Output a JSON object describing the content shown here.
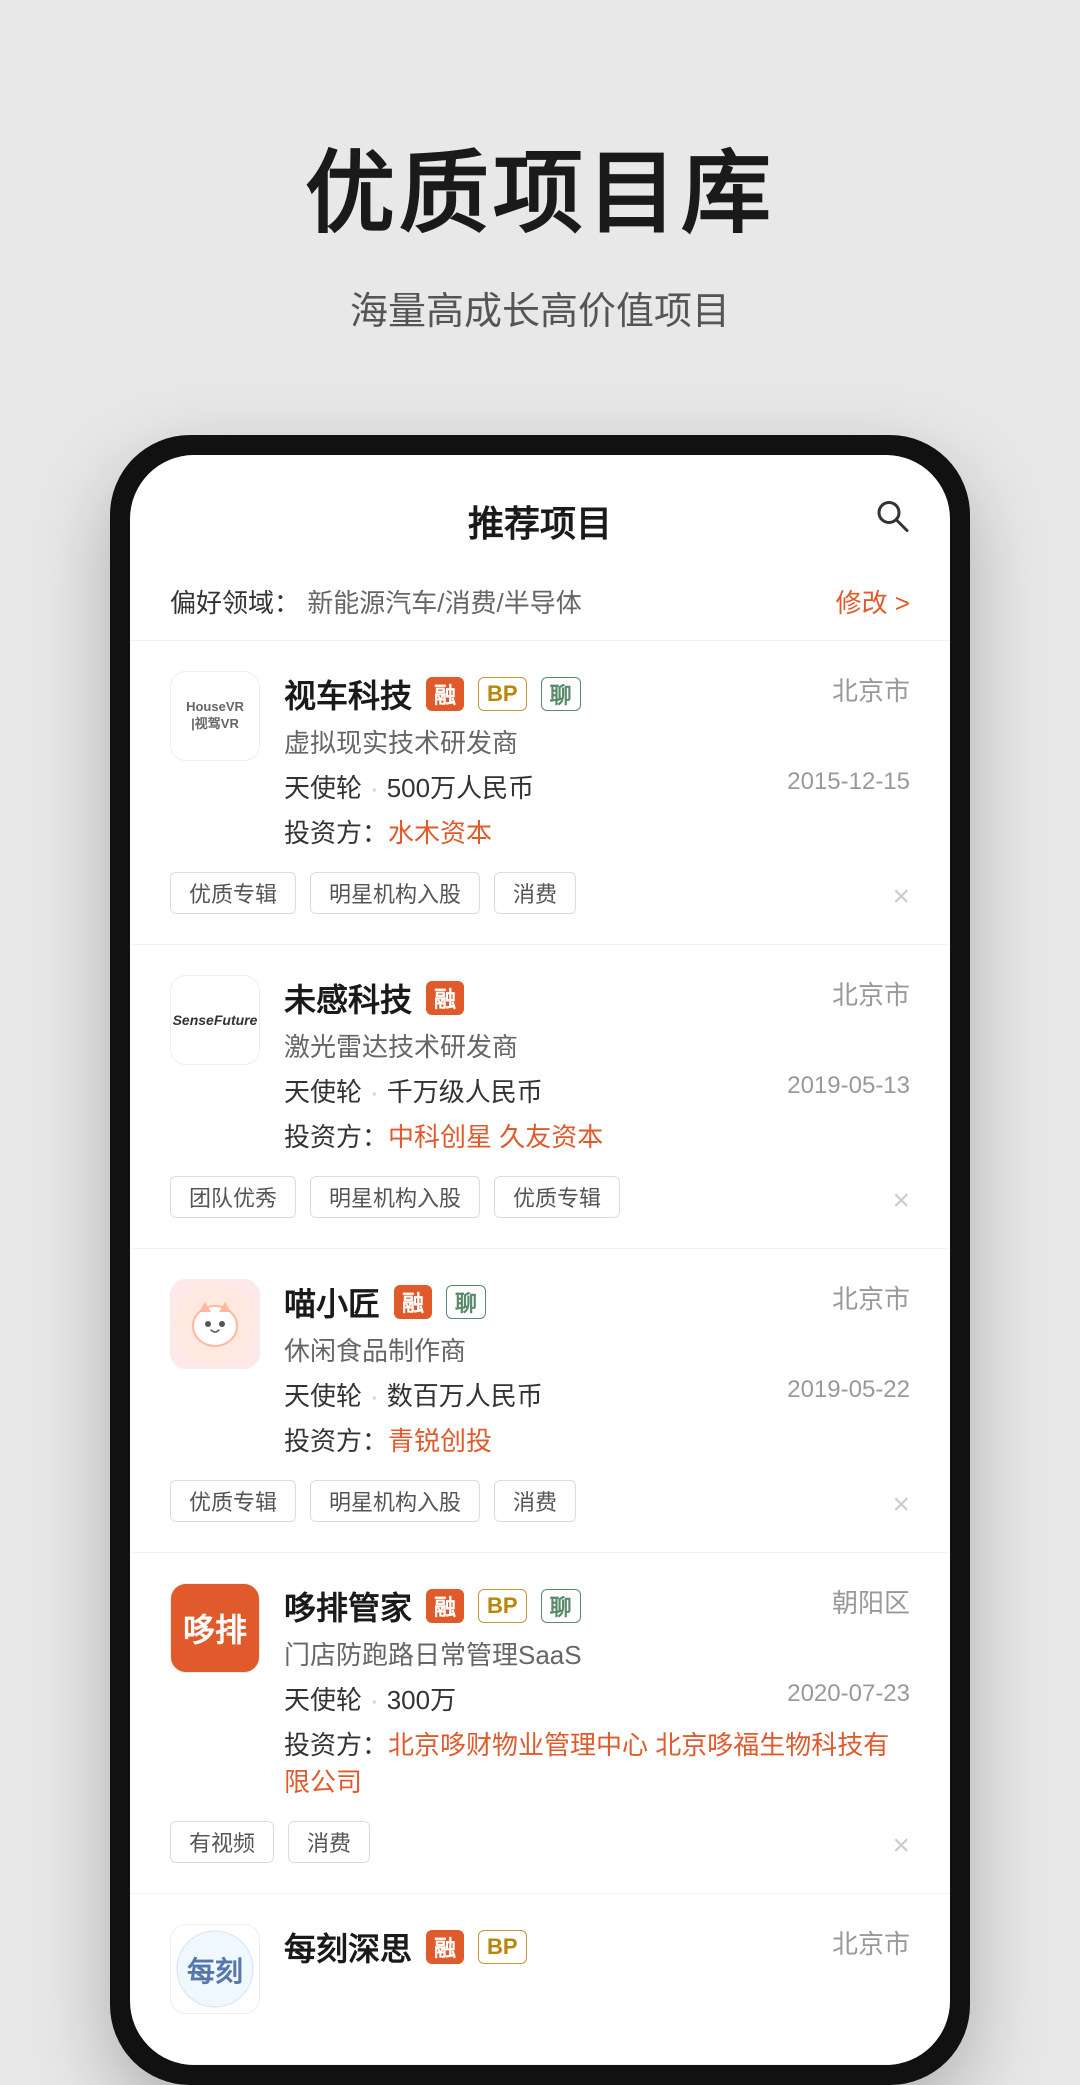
{
  "hero": {
    "title": "优质项目库",
    "subtitle": "海量高成长高价值项目"
  },
  "app": {
    "header_title": "推荐项目",
    "search_icon": "🔍",
    "preference_label": "偏好领域：",
    "preference_value": "新能源汽车/消费/半导体",
    "preference_edit": "修改 >"
  },
  "projects": [
    {
      "id": 1,
      "name": "视车科技",
      "logo_text": "HouseVR | 视驾VR",
      "logo_type": "housevr",
      "city": "北京市",
      "desc": "虚拟现实技术研发商",
      "round": "天使轮",
      "amount": "500万人民币",
      "date": "2015-12-15",
      "investor_label": "投资方：",
      "investors": [
        "水木资本"
      ],
      "tags": [
        "优质专辑",
        "明星机构入股",
        "消费"
      ],
      "badges": [
        "融",
        "BP",
        "聊"
      ]
    },
    {
      "id": 2,
      "name": "未感科技",
      "logo_text": "SenseFuture",
      "logo_type": "sensetime",
      "city": "北京市",
      "desc": "激光雷达技术研发商",
      "round": "天使轮",
      "amount": "千万级人民币",
      "date": "2019-05-13",
      "investor_label": "投资方：",
      "investors": [
        "中科创星",
        "久友资本"
      ],
      "tags": [
        "团队优秀",
        "明星机构入股",
        "优质专辑"
      ],
      "badges": [
        "融"
      ]
    },
    {
      "id": 3,
      "name": "喵小匠",
      "logo_text": "喵小匠",
      "logo_type": "miaoxiaojiang",
      "city": "北京市",
      "desc": "休闲食品制作商",
      "round": "天使轮",
      "amount": "数百万人民币",
      "date": "2019-05-22",
      "investor_label": "投资方：",
      "investors": [
        "青锐创投"
      ],
      "tags": [
        "优质专辑",
        "明星机构入股",
        "消费"
      ],
      "badges": [
        "融",
        "聊"
      ]
    },
    {
      "id": 4,
      "name": "哆排管家",
      "logo_text": "哆排",
      "logo_type": "duopai",
      "city": "朝阳区",
      "desc": "门店防跑路日常管理SaaS",
      "round": "天使轮",
      "amount": "300万",
      "date": "2020-07-23",
      "investor_label": "投资方：",
      "investors": [
        "北京哆财物业管理中心",
        "北京哆福生物科技有限公司"
      ],
      "tags": [
        "有视频",
        "消费"
      ],
      "badges": [
        "融",
        "BP",
        "聊"
      ]
    },
    {
      "id": 5,
      "name": "每刻深思",
      "logo_text": "每刻",
      "logo_type": "meike",
      "city": "北京市",
      "desc": "",
      "round": "",
      "amount": "",
      "date": "",
      "investor_label": "",
      "investors": [],
      "tags": [],
      "badges": [
        "融",
        "BP"
      ]
    }
  ],
  "badge_colors": {
    "融": "rong",
    "BP": "bp",
    "聊": "liao"
  }
}
